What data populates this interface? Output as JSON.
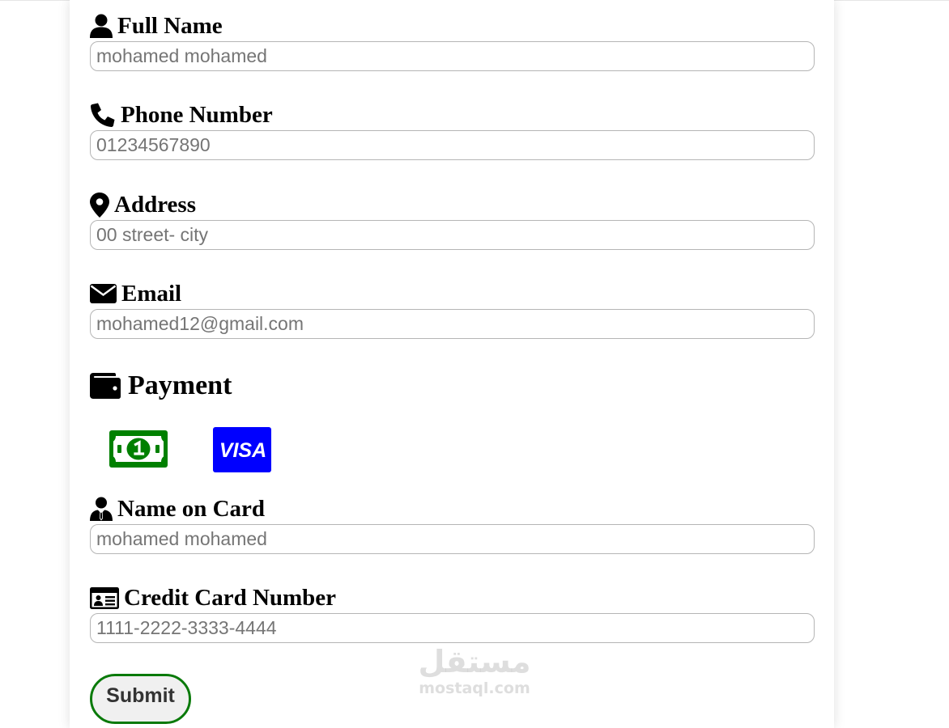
{
  "form": {
    "full_name": {
      "label": "Full Name",
      "placeholder": "mohamed mohamed",
      "icon": "user-icon"
    },
    "phone": {
      "label": "Phone Number",
      "placeholder": "01234567890",
      "icon": "phone-icon"
    },
    "address": {
      "label": "Address",
      "placeholder": "00 street- city",
      "icon": "map-marker-icon"
    },
    "email": {
      "label": "Email",
      "placeholder": "mohamed12@gmail.com",
      "icon": "envelope-icon"
    },
    "payment": {
      "heading": "Payment",
      "icon": "wallet-icon",
      "methods": [
        {
          "name": "cash",
          "icon": "money-bill-icon",
          "color": "#008000"
        },
        {
          "name": "visa",
          "icon": "visa-icon",
          "label": "VISA",
          "color": "#0000ff"
        }
      ]
    },
    "name_on_card": {
      "label": "Name on Card",
      "placeholder": "mohamed mohamed",
      "icon": "user-tie-icon"
    },
    "card_number": {
      "label": "Credit Card Number",
      "placeholder": "1111-2222-3333-4444",
      "icon": "id-card-icon"
    },
    "submit_label": "Submit"
  },
  "watermark": {
    "arabic": "مستقل",
    "latin": "mostaql.com"
  },
  "colors": {
    "submit_border": "#0a7a0a",
    "input_border": "#b5b5b5"
  }
}
